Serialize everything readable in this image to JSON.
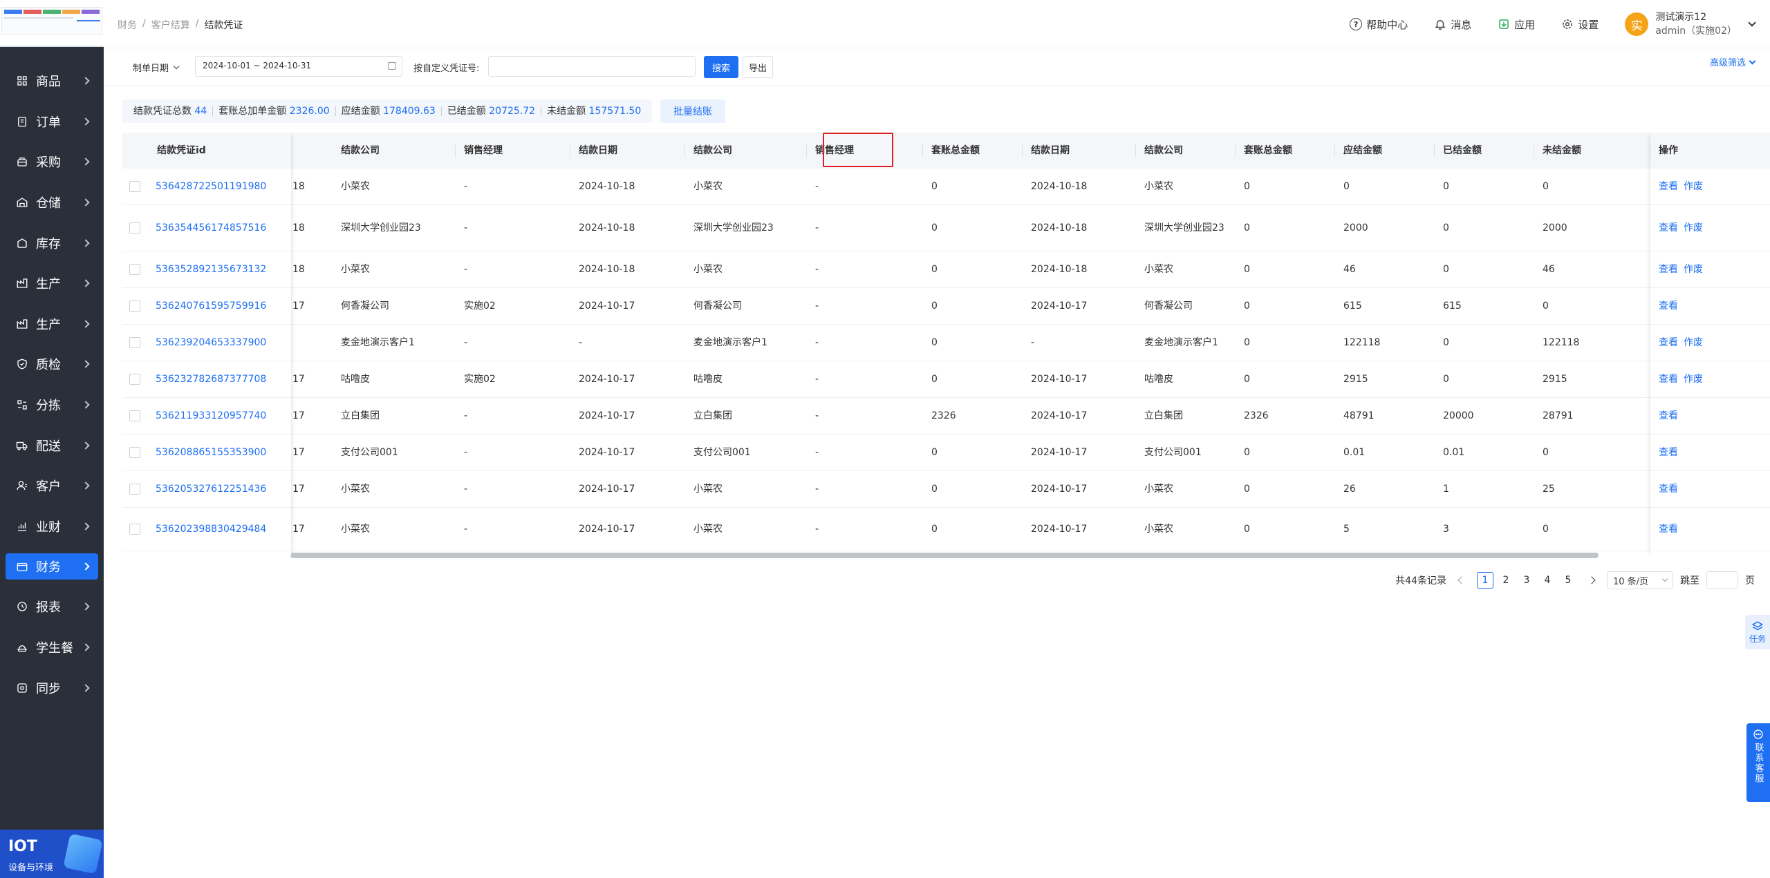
{
  "breadcrumb": [
    "财务",
    "客户结算",
    "结款凭证"
  ],
  "header": {
    "help": "帮助中心",
    "message": "消息",
    "apps": "应用",
    "settings": "设置",
    "avatar_char": "实",
    "user_name": "测试演示12",
    "user_role": "admin（实施02）"
  },
  "sidebar": {
    "items": [
      {
        "label": "商品",
        "icon": "grid-icon"
      },
      {
        "label": "订单",
        "icon": "order-icon"
      },
      {
        "label": "采购",
        "icon": "purchase-icon"
      },
      {
        "label": "仓储",
        "icon": "warehouse-icon"
      },
      {
        "label": "库存",
        "icon": "inventory-icon"
      },
      {
        "label": "生产",
        "icon": "factory-icon"
      },
      {
        "label": "生产",
        "icon": "factory-icon"
      },
      {
        "label": "质检",
        "icon": "shield-icon"
      },
      {
        "label": "分拣",
        "icon": "sort-icon"
      },
      {
        "label": "配送",
        "icon": "truck-icon"
      },
      {
        "label": "客户",
        "icon": "customer-icon"
      },
      {
        "label": "业财",
        "icon": "chart-icon"
      },
      {
        "label": "财务",
        "icon": "wallet-icon",
        "active": true
      },
      {
        "label": "报表",
        "icon": "report-icon"
      },
      {
        "label": "学生餐",
        "icon": "meal-icon"
      },
      {
        "label": "同步",
        "icon": "sync-icon"
      }
    ],
    "iot_title": "IOT",
    "iot_subtitle": "设备与环境"
  },
  "filter": {
    "date_label": "制单日期",
    "date_value": "2024-10-01 ~ 2024-10-31",
    "voucher_label": "按自定义凭证号:",
    "voucher_value": "",
    "search": "搜索",
    "export": "导出",
    "advanced": "高级筛选"
  },
  "summary": [
    {
      "label": "结款凭证总数",
      "value": "44"
    },
    {
      "label": "套账总加单金额",
      "value": "2326.00"
    },
    {
      "label": "应结金额",
      "value": "178409.63"
    },
    {
      "label": "已结金额",
      "value": "20725.72"
    },
    {
      "label": "未结金额",
      "value": "157571.50"
    }
  ],
  "batch_button": "批量结账",
  "table": {
    "headers": {
      "id": "结款凭证id",
      "c1": "结款公司",
      "c2": "销售经理",
      "c3": "结款日期",
      "c4": "结款公司",
      "c5": "销售经理",
      "c6": "套账总金额",
      "c7": "结款日期",
      "c8": "结款公司",
      "c9": "套账总金额",
      "c10": "应结金额",
      "c11": "已结金额",
      "c12": "未结金额",
      "ops": "操作"
    },
    "rows": [
      {
        "id": "536428722501191980",
        "p": "18",
        "c1": "小菜农",
        "c2": "-",
        "c3": "2024-10-18",
        "c4": "小菜农",
        "c5": "-",
        "c6": "0",
        "c7": "2024-10-18",
        "c8": "小菜农",
        "c9": "0",
        "c10": "0",
        "c11": "0",
        "c12": "0",
        "ops": [
          "查看",
          "作废"
        ]
      },
      {
        "id": "536354456174857516",
        "p": "18",
        "c1": "深圳大学创业园23",
        "c2": "-",
        "c3": "2024-10-18",
        "c4": "深圳大学创业园23",
        "c5": "-",
        "c6": "0",
        "c7": "2024-10-18",
        "c8": "深圳大学创业园23",
        "c9": "0",
        "c10": "2000",
        "c11": "0",
        "c12": "2000",
        "ops": [
          "查看",
          "作废"
        ]
      },
      {
        "id": "536352892135673132",
        "p": "18",
        "c1": "小菜农",
        "c2": "-",
        "c3": "2024-10-18",
        "c4": "小菜农",
        "c5": "-",
        "c6": "0",
        "c7": "2024-10-18",
        "c8": "小菜农",
        "c9": "0",
        "c10": "46",
        "c11": "0",
        "c12": "46",
        "ops": [
          "查看",
          "作废"
        ]
      },
      {
        "id": "536240761595759916",
        "p": "17",
        "c1": "何香凝公司",
        "c2": "实施02",
        "c3": "2024-10-17",
        "c4": "何香凝公司",
        "c5": "-",
        "c6": "0",
        "c7": "2024-10-17",
        "c8": "何香凝公司",
        "c9": "0",
        "c10": "615",
        "c11": "615",
        "c12": "0",
        "ops": [
          "查看"
        ]
      },
      {
        "id": "536239204653337900",
        "p": "",
        "c1": "麦金地演示客户1",
        "c2": "-",
        "c3": "-",
        "c4": "麦金地演示客户1",
        "c5": "-",
        "c6": "0",
        "c7": "-",
        "c8": "麦金地演示客户1",
        "c9": "0",
        "c10": "122118",
        "c11": "0",
        "c12": "122118",
        "ops": [
          "查看",
          "作废"
        ]
      },
      {
        "id": "536232782687377708",
        "p": "17",
        "c1": "咕噜皮",
        "c2": "实施02",
        "c3": "2024-10-17",
        "c4": "咕噜皮",
        "c5": "-",
        "c6": "0",
        "c7": "2024-10-17",
        "c8": "咕噜皮",
        "c9": "0",
        "c10": "2915",
        "c11": "0",
        "c12": "2915",
        "ops": [
          "查看",
          "作废"
        ]
      },
      {
        "id": "536211933120957740",
        "p": "17",
        "c1": "立白集团",
        "c2": "-",
        "c3": "2024-10-17",
        "c4": "立白集团",
        "c5": "-",
        "c6": "2326",
        "c7": "2024-10-17",
        "c8": "立白集团",
        "c9": "2326",
        "c10": "48791",
        "c11": "20000",
        "c12": "28791",
        "ops": [
          "查看"
        ]
      },
      {
        "id": "536208865155353900",
        "p": "17",
        "c1": "支付公司001",
        "c2": "-",
        "c3": "2024-10-17",
        "c4": "支付公司001",
        "c5": "-",
        "c6": "0",
        "c7": "2024-10-17",
        "c8": "支付公司001",
        "c9": "0",
        "c10": "0.01",
        "c11": "0.01",
        "c12": "0",
        "ops": [
          "查看"
        ]
      },
      {
        "id": "536205327612251436",
        "p": "17",
        "c1": "小菜农",
        "c2": "-",
        "c3": "2024-10-17",
        "c4": "小菜农",
        "c5": "-",
        "c6": "0",
        "c7": "2024-10-17",
        "c8": "小菜农",
        "c9": "0",
        "c10": "26",
        "c11": "1",
        "c12": "25",
        "ops": [
          "查看"
        ]
      },
      {
        "id": "536202398830429484",
        "p": "17",
        "c1": "小菜农",
        "c2": "-",
        "c3": "2024-10-17",
        "c4": "小菜农",
        "c5": "-",
        "c6": "0",
        "c7": "2024-10-17",
        "c8": "小菜农",
        "c9": "0",
        "c10": "5",
        "c11": "3",
        "c12": "0",
        "ops": [
          "查看"
        ]
      }
    ]
  },
  "pager": {
    "total": "共44条记录",
    "pages": [
      "1",
      "2",
      "3",
      "4",
      "5"
    ],
    "current": "1",
    "size": "10 条/页",
    "jump_label": "跳至",
    "page_unit": "页"
  },
  "float": {
    "task": "任务",
    "contact": "联系客服"
  }
}
